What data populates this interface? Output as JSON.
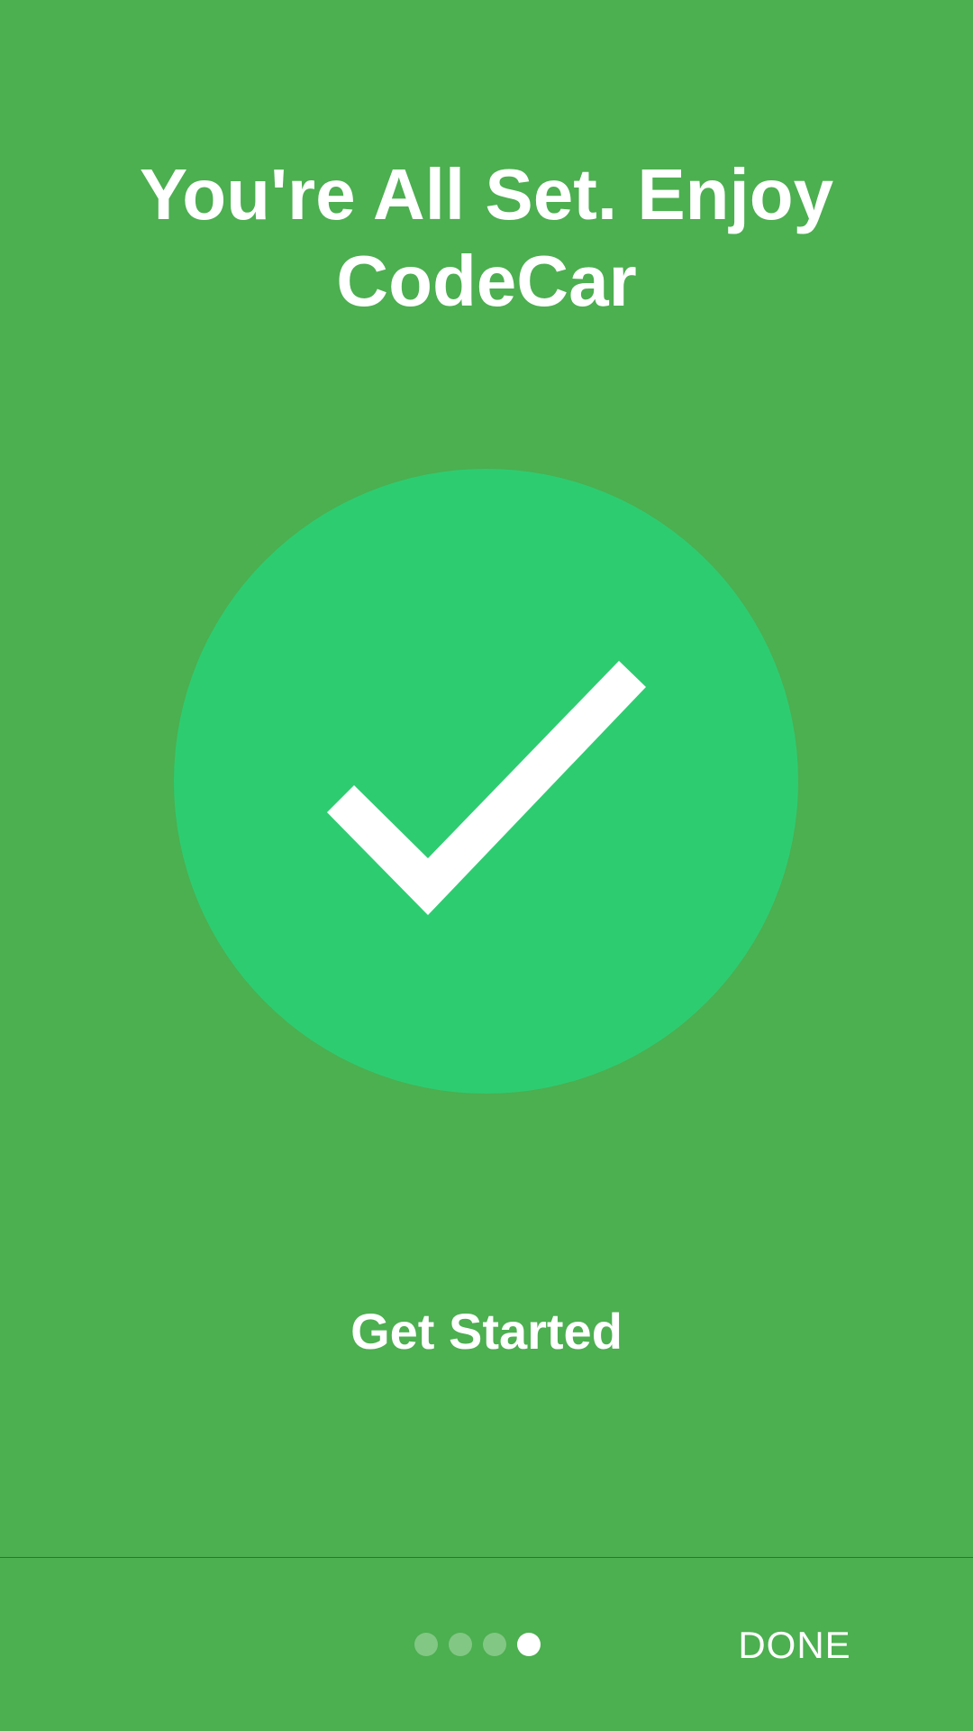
{
  "title": "You're All Set. Enjoy CodeCar",
  "cta": {
    "label": "Get Started"
  },
  "pager": {
    "dots": [
      {
        "active": false
      },
      {
        "active": false
      },
      {
        "active": false
      },
      {
        "active": true
      }
    ]
  },
  "footer": {
    "done_label": "DONE"
  },
  "colors": {
    "background": "#4CAF50",
    "circle": "#2ECC71",
    "foreground": "#FFFFFF"
  },
  "icons": {
    "hero": "checkmark-icon"
  }
}
